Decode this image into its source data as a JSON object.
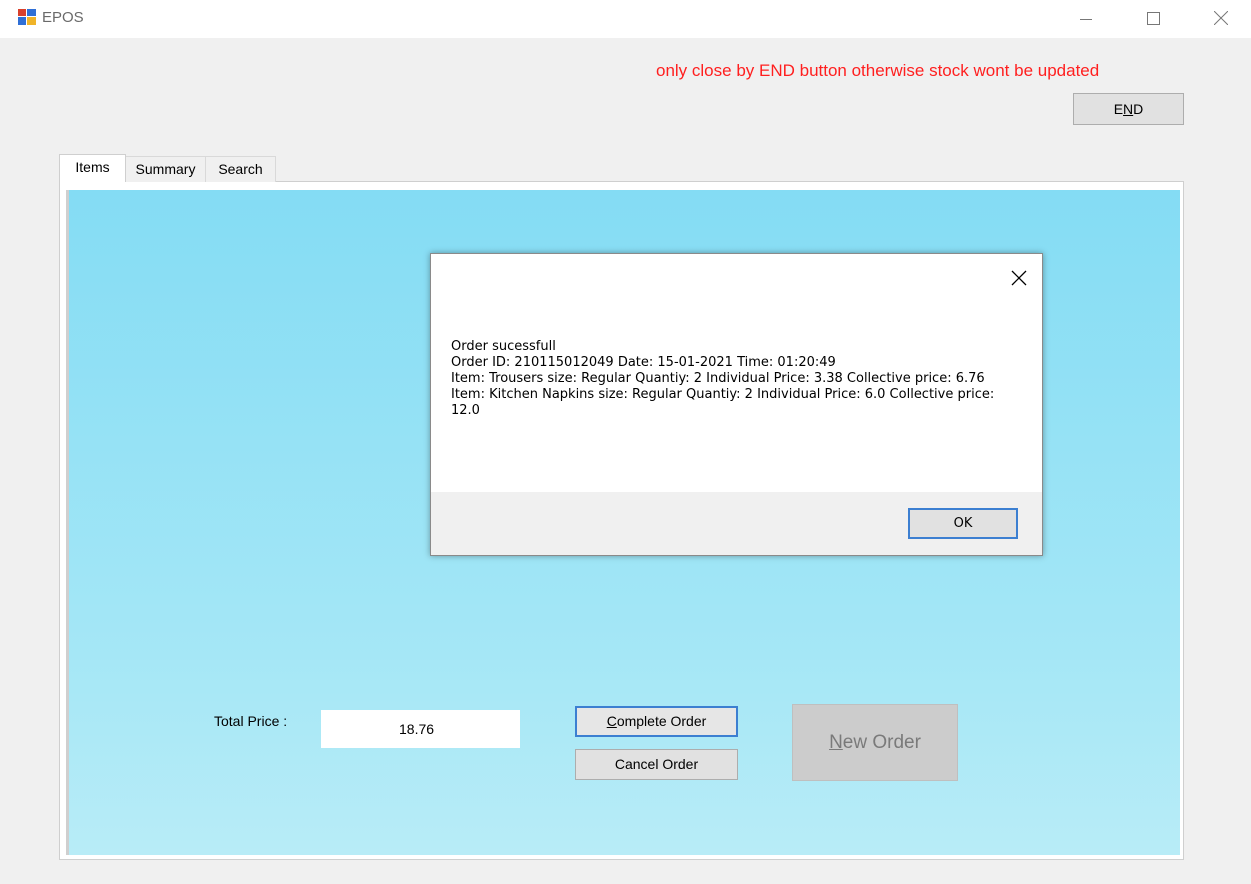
{
  "window": {
    "title": "EPOS",
    "icon": "app-icon",
    "controls": [
      "minimize-icon",
      "maximize-icon",
      "close-icon"
    ]
  },
  "warning": {
    "text": "only close by END button otherwise stock wont be updated",
    "color": "#ff1f1f"
  },
  "end_button": {
    "pre": "E",
    "accel": "N",
    "post": "D"
  },
  "tabs": [
    {
      "label": "Items",
      "selected": true
    },
    {
      "label": "Summary",
      "selected": false
    },
    {
      "label": "Search",
      "selected": false
    }
  ],
  "items_panel": {
    "total_label": "Total Price :",
    "total_value": "18.76",
    "complete_order": {
      "accel": "C",
      "rest": "omplete Order"
    },
    "cancel_order": "Cancel Order",
    "new_order": {
      "accel": "N",
      "rest": "ew Order"
    }
  },
  "dialog": {
    "lines": [
      "Order sucessfull",
      "Order ID: 210115012049 Date: 15-01-2021 Time: 01:20:49",
      "Item: Trousers size: Regular Quantiy: 2 Individual Price: 3.38 Collective price: 6.76",
      "Item: Kitchen Napkins size: Regular Quantiy: 2 Individual Price: 6.0 Collective price: 12.0"
    ],
    "ok_label": "OK"
  },
  "colors": {
    "panel_gradient_top": "#84dcf4",
    "panel_gradient_bottom": "#b8ecf7",
    "focus_border": "#3c7fd1"
  }
}
